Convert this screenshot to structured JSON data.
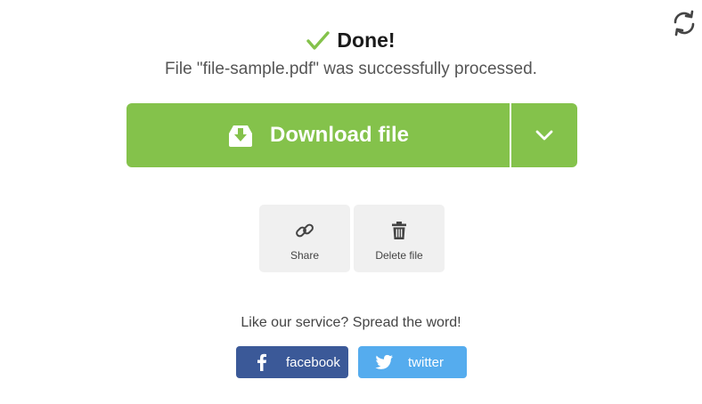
{
  "status": {
    "title": "Done!",
    "message": "File \"file-sample.pdf\" was successfully processed."
  },
  "download": {
    "label": "Download file"
  },
  "actions": [
    {
      "label": "Share"
    },
    {
      "label": "Delete file"
    }
  ],
  "promo": {
    "text": "Like our service? Spread the word!",
    "facebook_label": "facebook",
    "twitter_label": "twitter"
  },
  "colors": {
    "accent_green": "#84c24b",
    "facebook_blue": "#3b5998",
    "twitter_blue": "#55acee",
    "action_bg": "#f0f0f0"
  },
  "icons": [
    "refresh-icon",
    "checkmark-icon",
    "download-icon",
    "chevron-down-icon",
    "link-icon",
    "trash-icon",
    "facebook-icon",
    "twitter-icon"
  ]
}
